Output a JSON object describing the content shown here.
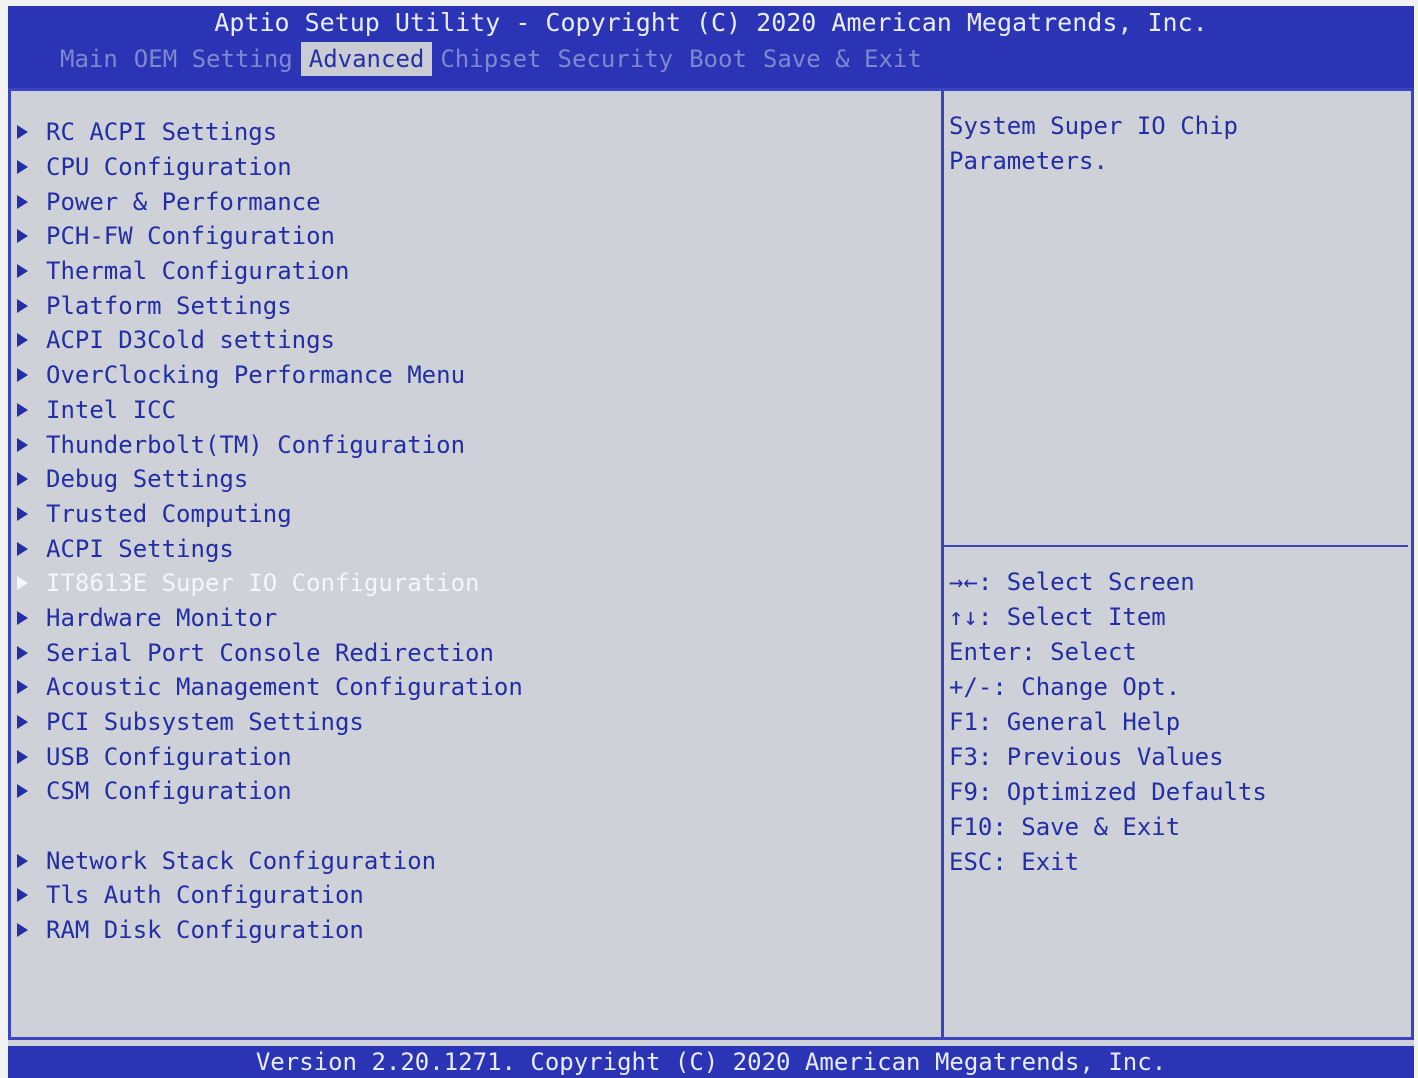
{
  "header": {
    "title": "Aptio Setup Utility - Copyright (C) 2020 American Megatrends, Inc.",
    "tabs": [
      {
        "label": "Main"
      },
      {
        "label": "OEM Setting"
      },
      {
        "label": "Advanced"
      },
      {
        "label": "Chipset"
      },
      {
        "label": "Security"
      },
      {
        "label": "Boot"
      },
      {
        "label": "Save & Exit"
      }
    ],
    "active_tab": "Advanced"
  },
  "menu": {
    "items": [
      {
        "label": "RC ACPI Settings"
      },
      {
        "label": "CPU Configuration"
      },
      {
        "label": "Power & Performance"
      },
      {
        "label": "PCH-FW Configuration"
      },
      {
        "label": "Thermal Configuration"
      },
      {
        "label": "Platform Settings"
      },
      {
        "label": "ACPI D3Cold settings"
      },
      {
        "label": "OverClocking Performance Menu"
      },
      {
        "label": "Intel ICC"
      },
      {
        "label": "Thunderbolt(TM) Configuration"
      },
      {
        "label": "Debug Settings"
      },
      {
        "label": "Trusted Computing"
      },
      {
        "label": "ACPI Settings"
      },
      {
        "label": "IT8613E Super IO Configuration"
      },
      {
        "label": "Hardware Monitor"
      },
      {
        "label": "Serial Port Console Redirection"
      },
      {
        "label": "Acoustic Management Configuration"
      },
      {
        "label": "PCI Subsystem Settings"
      },
      {
        "label": "USB Configuration"
      },
      {
        "label": "CSM Configuration"
      },
      {
        "label": "Network Stack Configuration"
      },
      {
        "label": "Tls Auth Configuration"
      },
      {
        "label": "RAM Disk Configuration"
      }
    ],
    "selected_label": "IT8613E Super IO Configuration"
  },
  "help": {
    "text": "System Super IO Chip\nParameters."
  },
  "keys": [
    "→←: Select Screen",
    "↑↓: Select Item",
    "Enter: Select",
    "+/-: Change Opt.",
    "F1: General Help",
    "F3: Previous Values",
    "F9: Optimized Defaults",
    "F10: Save & Exit",
    "ESC: Exit"
  ],
  "footer": {
    "text": "Version 2.20.1271. Copyright (C) 2020 American Megatrends, Inc."
  },
  "colors": {
    "header_bg": "#2b34b4",
    "content_bg": "#cfd1d8",
    "text_blue": "#222ea6",
    "selected_text": "#f4f5ff",
    "inactive_tab": "#7f88cf"
  }
}
